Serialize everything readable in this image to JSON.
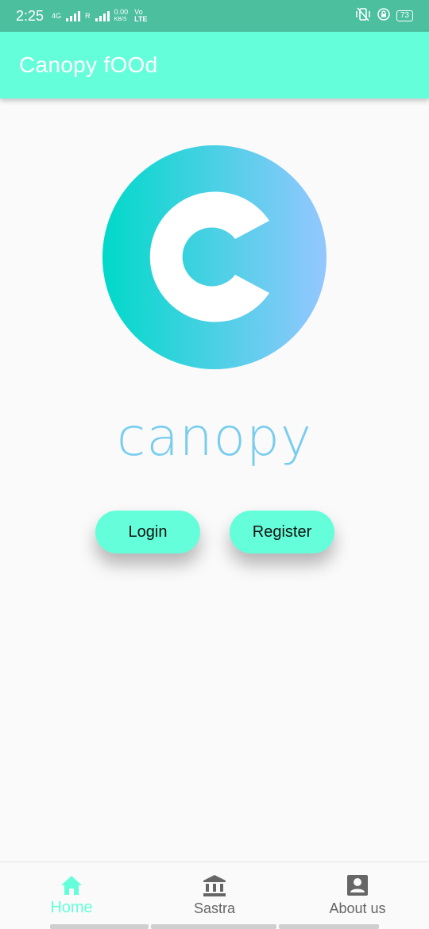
{
  "status_bar": {
    "time": "2:25",
    "network_1": "4G",
    "network_2": "R",
    "speed_value": "0.00",
    "speed_unit": "KB/S",
    "volte_top": "Vo",
    "volte_bottom": "LTE",
    "battery": "73"
  },
  "app_bar": {
    "title": "Canopy fOOd"
  },
  "logo": {
    "wordmark": "canopy",
    "gradient_start": "#00d9c9",
    "gradient_end": "#94c7ff",
    "wordmark_color": "#78cdef"
  },
  "buttons": {
    "login": "Login",
    "register": "Register"
  },
  "bottom_nav": {
    "items": [
      {
        "label": "Home",
        "icon": "home-icon",
        "active": true
      },
      {
        "label": "Sastra",
        "icon": "bank-icon",
        "active": false
      },
      {
        "label": "About us",
        "icon": "account-box-icon",
        "active": false
      }
    ]
  },
  "colors": {
    "accent": "#64ffda",
    "status_bar": "#4cbf9f",
    "background": "#fafafa"
  }
}
